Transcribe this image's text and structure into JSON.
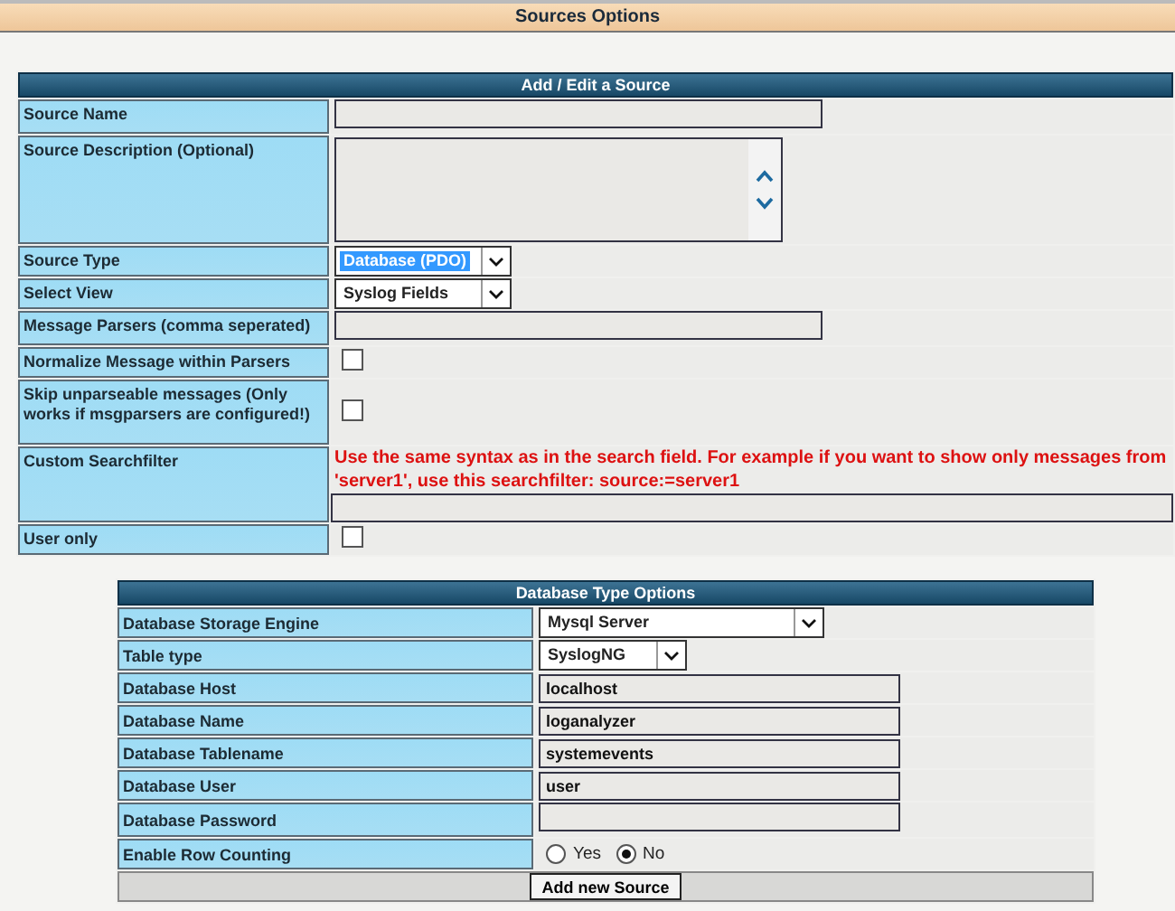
{
  "page_title": "Sources Options",
  "source_form": {
    "title": "Add / Edit a Source",
    "rows": [
      {
        "label": "Source Name",
        "kind": "text",
        "value": ""
      },
      {
        "label": "Source Description (Optional)",
        "kind": "textarea",
        "value": ""
      },
      {
        "label": "Source Type",
        "kind": "select",
        "value": "Database (PDO)",
        "highlighted": true
      },
      {
        "label": "Select View",
        "kind": "select",
        "value": "Syslog Fields",
        "highlighted": false
      },
      {
        "label": "Message Parsers (comma seperated)",
        "kind": "text",
        "value": ""
      },
      {
        "label": "Normalize Message within Parsers",
        "kind": "checkbox",
        "checked": false
      },
      {
        "label": "Skip unparseable messages (Only works if msgparsers are configured!)",
        "kind": "checkbox",
        "checked": false
      },
      {
        "label": "Custom Searchfilter",
        "kind": "filter",
        "hint": "Use the same syntax as in the search field. For example if you want to show only messages from 'server1', use this searchfilter: source:=server1",
        "value": ""
      },
      {
        "label": "User only",
        "kind": "checkbox",
        "checked": false
      }
    ]
  },
  "database_form": {
    "title": "Database Type Options",
    "rows": [
      {
        "label": "Database Storage Engine",
        "kind": "select",
        "value": "Mysql Server",
        "highlighted": false
      },
      {
        "label": "Table type",
        "kind": "select",
        "value": "SyslogNG",
        "highlighted": false
      },
      {
        "label": "Database Host",
        "kind": "text",
        "value": "localhost"
      },
      {
        "label": "Database Name",
        "kind": "text",
        "value": "loganalyzer"
      },
      {
        "label": "Database Tablename",
        "kind": "text",
        "value": "systemevents"
      },
      {
        "label": "Database User",
        "kind": "text",
        "value": "user"
      },
      {
        "label": "Database Password",
        "kind": "text",
        "value": ""
      },
      {
        "label": "Enable Row Counting",
        "kind": "radio",
        "options": [
          {
            "label": "Yes",
            "selected": false
          },
          {
            "label": "No",
            "selected": true
          }
        ]
      }
    ],
    "button": "Add new Source"
  }
}
